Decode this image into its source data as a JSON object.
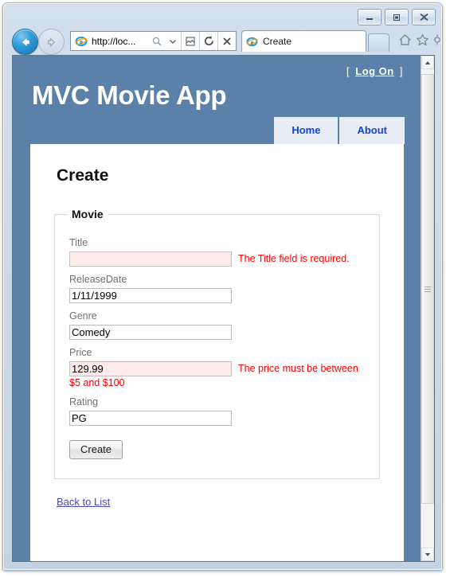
{
  "browser": {
    "name": "Internet Explorer",
    "window_controls": [
      {
        "name": "minimize",
        "label": "Minimize"
      },
      {
        "name": "maximize",
        "label": "Maximize"
      },
      {
        "name": "close",
        "label": "Close"
      }
    ],
    "back_button_label": "Back",
    "forward_button_label": "Forward",
    "address": {
      "url_text": "http://loc...",
      "placeholder": "http://loc...",
      "favicon": "ie-logo-icon",
      "search_icon": "search-icon",
      "dropdown_icon": "chevron-down-icon",
      "compat_icon": "compatibility-view-icon",
      "refresh_icon": "refresh-icon",
      "stop_icon": "stop-icon"
    },
    "tab": {
      "title": "Create",
      "favicon": "ie-logo-icon"
    },
    "new_tab_label": "",
    "command_icons": [
      {
        "name": "home-icon",
        "label": "Home"
      },
      {
        "name": "favorites-star-icon",
        "label": "Favorites"
      },
      {
        "name": "tools-gear-icon",
        "label": "Tools"
      }
    ],
    "scrollbar": {
      "up_arrow": "scroll-up-icon",
      "down_arrow": "scroll-down-icon"
    }
  },
  "site": {
    "title": "MVC Movie App",
    "logon": {
      "open_bracket": "[",
      "link_text": "Log On",
      "close_bracket": "]"
    },
    "menu": [
      {
        "label": "Home"
      },
      {
        "label": "About"
      }
    ],
    "colors": {
      "header_blue": "#5b81a8",
      "menu_bg": "#e8edf4",
      "menu_text": "#1144dd",
      "error_red": "#ff0000",
      "error_field_bg": "#fdeaea",
      "link_purple": "#4a49b5"
    }
  },
  "page": {
    "heading": "Create",
    "fieldset_legend": "Movie",
    "fields": [
      {
        "label": "Title",
        "value": "",
        "has_error": true,
        "error": "The Title field is required.",
        "error_overflow": ""
      },
      {
        "label": "ReleaseDate",
        "value": "1/11/1999",
        "has_error": false,
        "error": "",
        "error_overflow": ""
      },
      {
        "label": "Genre",
        "value": "Comedy",
        "has_error": false,
        "error": "",
        "error_overflow": ""
      },
      {
        "label": "Price",
        "value": "129.99",
        "has_error": true,
        "error": "The price must be between",
        "error_overflow": "$5 and $100"
      },
      {
        "label": "Rating",
        "value": "PG",
        "has_error": false,
        "error": "",
        "error_overflow": ""
      }
    ],
    "submit_label": "Create",
    "back_link": "Back to List"
  }
}
